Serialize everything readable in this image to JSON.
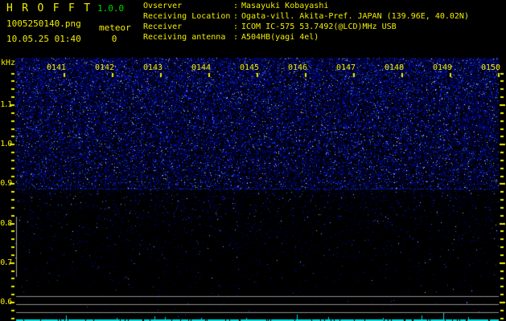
{
  "header": {
    "app_title": "H R O F F T",
    "app_version": "1.0.0",
    "filename": "1005250140.png",
    "mode_label": "meteor",
    "datetime": "10.05.25 01:40",
    "meteor_count": "0",
    "colon": ":",
    "info_rows": [
      {
        "label": "Ovserver",
        "value": "Masayuki Kobayashi"
      },
      {
        "label": "Receiving Location",
        "value": "Ogata-vill. Akita-Pref. JAPAN (139.96E, 40.02N)"
      },
      {
        "label": "Receiver",
        "value": "ICOM IC-575 53.7492(@LCD)MHz USB"
      },
      {
        "label": "Receiving antenna",
        "value": "A504HB(yagi 4el)"
      }
    ]
  },
  "colors": {
    "background": "#000000",
    "text_yellow": "#f2ee00",
    "version_green": "#00d400",
    "axis_yellow": "#f2ee00",
    "noise_blue": "#0000cc",
    "carrier_gray": "#8f8f8f",
    "marker_gray": "#9e9e9e",
    "trace_cyan": "#00dede"
  },
  "chart_data": {
    "type": "heatmap",
    "subtype": "radio-meteor-spectrogram",
    "title": "",
    "xlabel": "",
    "ylabel": "kHz",
    "x_tick_labels": [
      "0141",
      "0142",
      "0143",
      "0144",
      "0145",
      "0146",
      "0147",
      "0148",
      "0149",
      "0150"
    ],
    "x_range_time": [
      "0140",
      "0150"
    ],
    "y_major_tick_labels": [
      "1.1",
      "1.0",
      "0.9",
      "0.8",
      "0.7",
      "0.6"
    ],
    "y_minor_tick_step_khz": 0.02,
    "y_minor_tick_top_khz": 1.18,
    "y_range_khz": [
      0.555,
      1.22
    ],
    "grid": false,
    "legend": false,
    "meteor_echo_count": 0,
    "noise_boundary_khz": 0.886,
    "faint_carrier_khz": 0.886,
    "carrier_lines_khz": [
      0.614,
      0.594,
      0.574
    ],
    "left_edge_marker_khz": [
      0.663,
      0.815
    ],
    "noise": {
      "top_density": 0.5,
      "density_at_boundary": 0.3,
      "below_boundary_density": 0.1,
      "floor_density": 0.006
    },
    "level_trace": {
      "baseline": "continuous cyan line at bottom edge",
      "spikes_minутes_offset": [],
      "spikes": [
        {
          "min": 1.03,
          "h": 5
        },
        {
          "min": 2.08,
          "h": 2
        },
        {
          "min": 2.87,
          "h": 4
        },
        {
          "min": 3.08,
          "h": 3
        },
        {
          "min": 3.83,
          "h": 2
        },
        {
          "min": 4.77,
          "h": 2
        },
        {
          "min": 5.82,
          "h": 6
        },
        {
          "min": 6.47,
          "h": 3
        },
        {
          "min": 7.6,
          "h": 2
        },
        {
          "min": 8.4,
          "h": 5
        },
        {
          "min": 8.85,
          "h": 8
        },
        {
          "min": 9.37,
          "h": 3
        }
      ]
    }
  }
}
